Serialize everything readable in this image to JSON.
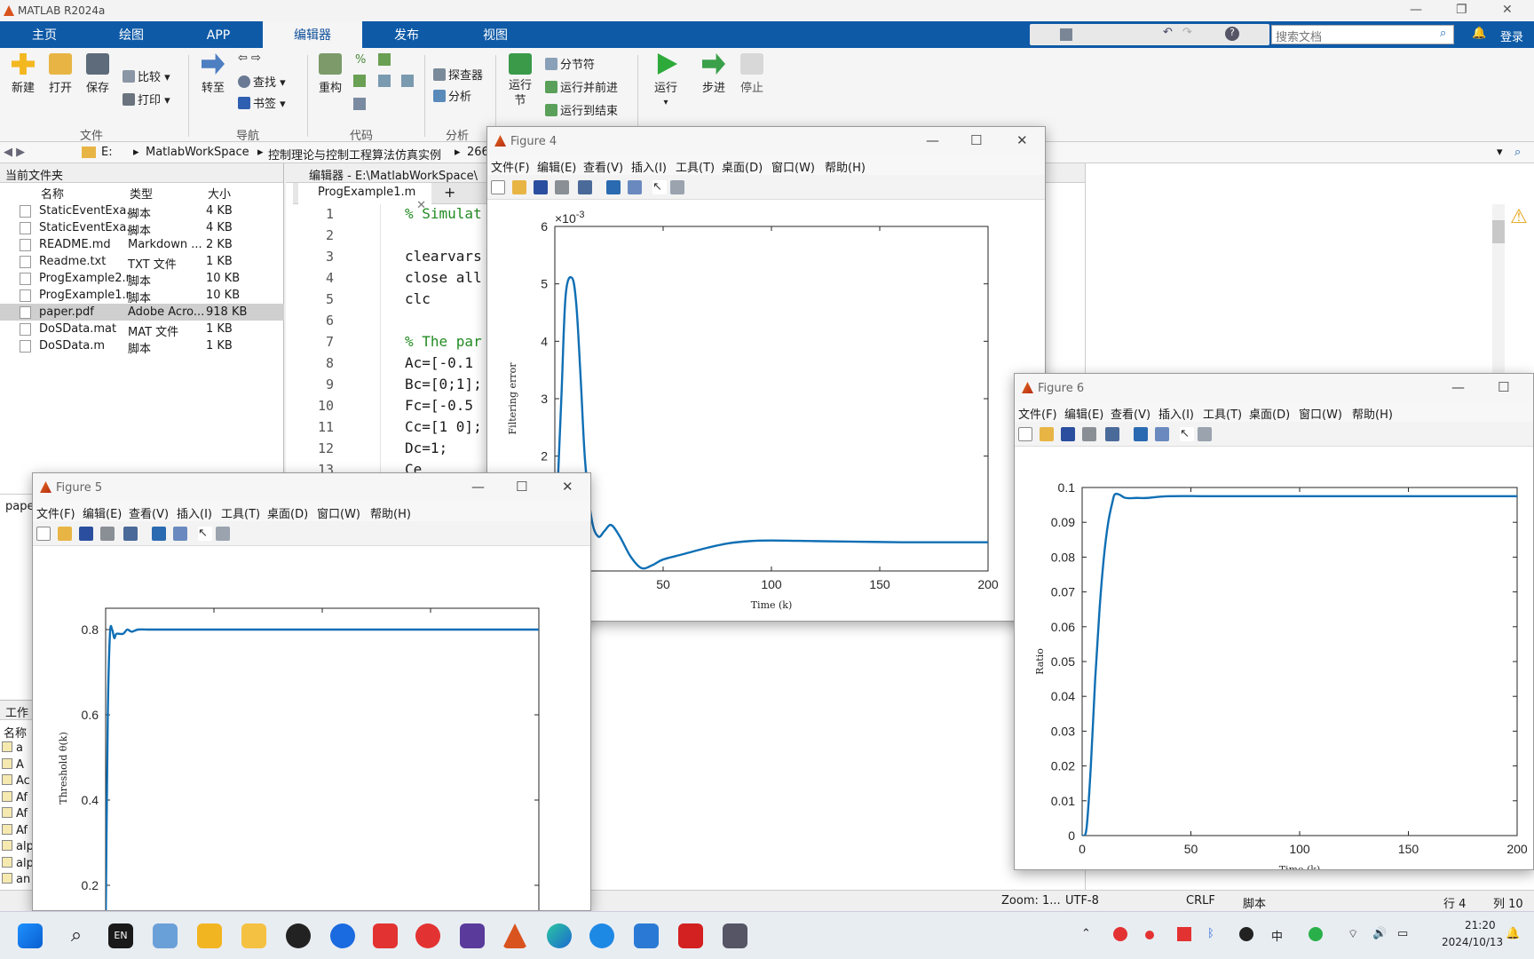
{
  "app": {
    "title": "MATLAB R2024a"
  },
  "tabs": [
    "主页",
    "绘图",
    "APP",
    "编辑器",
    "发布",
    "视图"
  ],
  "search": {
    "placeholder": "搜索文档"
  },
  "login": "登录",
  "ribbon": {
    "file": {
      "new": "新建",
      "open": "打开",
      "save": "保存",
      "compare": "比较",
      "print": "打印",
      "group": "文件"
    },
    "nav": {
      "goto": "转至",
      "find": "查找",
      "bookmark": "书签",
      "group": "导航"
    },
    "code": {
      "refactor": "重构",
      "group": "代码"
    },
    "analyze": {
      "explorer": "探查器",
      "analyze": "分析",
      "group": "分析"
    },
    "section": {
      "run_section": "运行节",
      "section_break": "分节符",
      "run_advance": "运行并前进",
      "run_to_end": "运行到结束"
    },
    "run": {
      "run": "运行",
      "step": "步进",
      "stop": "停止"
    }
  },
  "address": {
    "drive": "E:",
    "folder1": "MatlabWorkSpace",
    "folder2": "控制理论与控制工程算法仿真实例",
    "folder3": "266"
  },
  "current_folder": {
    "title": "当前文件夹",
    "headers": [
      "名称",
      "类型",
      "大小"
    ],
    "files": [
      {
        "name": "StaticEventExa...",
        "type": "脚本",
        "size": "4 KB"
      },
      {
        "name": "StaticEventExa...",
        "type": "脚本",
        "size": "4 KB"
      },
      {
        "name": "README.md",
        "type": "Markdown ...",
        "size": "2 KB"
      },
      {
        "name": "Readme.txt",
        "type": "TXT 文件",
        "size": "1 KB"
      },
      {
        "name": "ProgExample2.r",
        "type": "脚本",
        "size": "10 KB"
      },
      {
        "name": "ProgExample1.r",
        "type": "脚本",
        "size": "10 KB"
      },
      {
        "name": "paper.pdf",
        "type": "Adobe Acro...",
        "size": "918 KB"
      },
      {
        "name": "DoSData.mat",
        "type": "MAT 文件",
        "size": "1 KB"
      },
      {
        "name": "DoSData.m",
        "type": "脚本",
        "size": "1 KB"
      }
    ],
    "details_label": "pape"
  },
  "workspace": {
    "title": "工作",
    "name_header": "名称",
    "vars": [
      "a",
      "A",
      "Ac",
      "Af",
      "Af",
      "Af",
      "alp",
      "alp",
      "an"
    ]
  },
  "editor": {
    "title": "编辑器 - E:\\MatlabWorkSpace\\",
    "tab": "ProgExample1.m",
    "lines": [
      "% Simulat",
      "",
      "clearvars",
      "close all",
      "clc",
      "",
      "% The par",
      "Ac=[-0.1",
      "Bc=[0;1];",
      "Fc=[-0.5",
      "Cc=[1 0];",
      "Dc=1;",
      "Ce"
    ]
  },
  "status": {
    "zoom": "Zoom: 1...",
    "encoding": "UTF-8",
    "eol": "CRLF",
    "type": "脚本",
    "row": "行 4",
    "col": "列 10"
  },
  "figure_menu": [
    "文件(F)",
    "编辑(E)",
    "查看(V)",
    "插入(I)",
    "工具(T)",
    "桌面(D)",
    "窗口(W)",
    "帮助(H)"
  ],
  "figures": {
    "fig4": {
      "title": "Figure 4",
      "ylabel": "Filtering error",
      "xlabel": "Time (k)",
      "exponent": "×10-3"
    },
    "fig5": {
      "title": "Figure 5",
      "ylabel": "Threshold θ(k)"
    },
    "fig6": {
      "title": "Figure 6",
      "ylabel": "Ratio",
      "xlabel": "Time (k)"
    }
  },
  "taskbar": {
    "time": "21:20",
    "date": "2024/10/13",
    "ime": "中",
    "lang": "EN"
  },
  "chart_data": [
    {
      "type": "line",
      "title": "",
      "xlabel": "Time (k)",
      "ylabel": "Filtering error",
      "y_scale_label": "×10^-3",
      "xlim": [
        0,
        200
      ],
      "ylim": [
        0,
        6
      ],
      "x_ticks": [
        50,
        100,
        150,
        200
      ],
      "y_ticks": [
        2,
        3,
        4,
        5,
        6
      ],
      "series": [
        {
          "x": [
            0,
            3,
            5,
            8,
            10,
            12,
            14,
            17,
            20,
            23,
            26,
            30,
            35,
            40,
            45,
            50,
            60,
            70,
            80,
            90,
            100,
            120,
            140,
            160,
            180,
            200
          ],
          "y": [
            0.3,
            3.0,
            4.8,
            5.1,
            4.6,
            3.3,
            1.9,
            0.9,
            0.6,
            0.7,
            0.8,
            0.6,
            0.25,
            0.05,
            0.1,
            0.2,
            0.3,
            0.4,
            0.48,
            0.52,
            0.53,
            0.52,
            0.51,
            0.5,
            0.5,
            0.5
          ]
        }
      ]
    },
    {
      "type": "line",
      "title": "",
      "xlabel": "",
      "ylabel": "Threshold θ(k)",
      "xlim": [
        0,
        200
      ],
      "ylim": [
        0.1,
        0.85
      ],
      "y_ticks": [
        0.2,
        0.4,
        0.6,
        0.8
      ],
      "series": [
        {
          "x": [
            0,
            1,
            2,
            3,
            4,
            5,
            8,
            10,
            12,
            15,
            20,
            25,
            30,
            40,
            50,
            100,
            150,
            200
          ],
          "y": [
            0.1,
            0.6,
            0.79,
            0.8,
            0.78,
            0.79,
            0.79,
            0.8,
            0.795,
            0.8,
            0.8,
            0.8,
            0.8,
            0.8,
            0.8,
            0.8,
            0.8,
            0.8
          ]
        }
      ]
    },
    {
      "type": "line",
      "title": "",
      "xlabel": "Time (k)",
      "ylabel": "Ratio",
      "xlim": [
        0,
        200
      ],
      "ylim": [
        0,
        0.1
      ],
      "x_ticks": [
        0,
        50,
        100,
        150,
        200
      ],
      "y_ticks": [
        0,
        0.01,
        0.02,
        0.03,
        0.04,
        0.05,
        0.06,
        0.07,
        0.08,
        0.09,
        0.1
      ],
      "series": [
        {
          "x": [
            0,
            2,
            4,
            6,
            8,
            10,
            12,
            14,
            15,
            17,
            20,
            25,
            30,
            40,
            60,
            100,
            150,
            200
          ],
          "y": [
            0,
            0.002,
            0.02,
            0.045,
            0.065,
            0.08,
            0.09,
            0.096,
            0.098,
            0.098,
            0.097,
            0.097,
            0.097,
            0.0975,
            0.0975,
            0.0975,
            0.0975,
            0.0975
          ]
        }
      ]
    }
  ]
}
